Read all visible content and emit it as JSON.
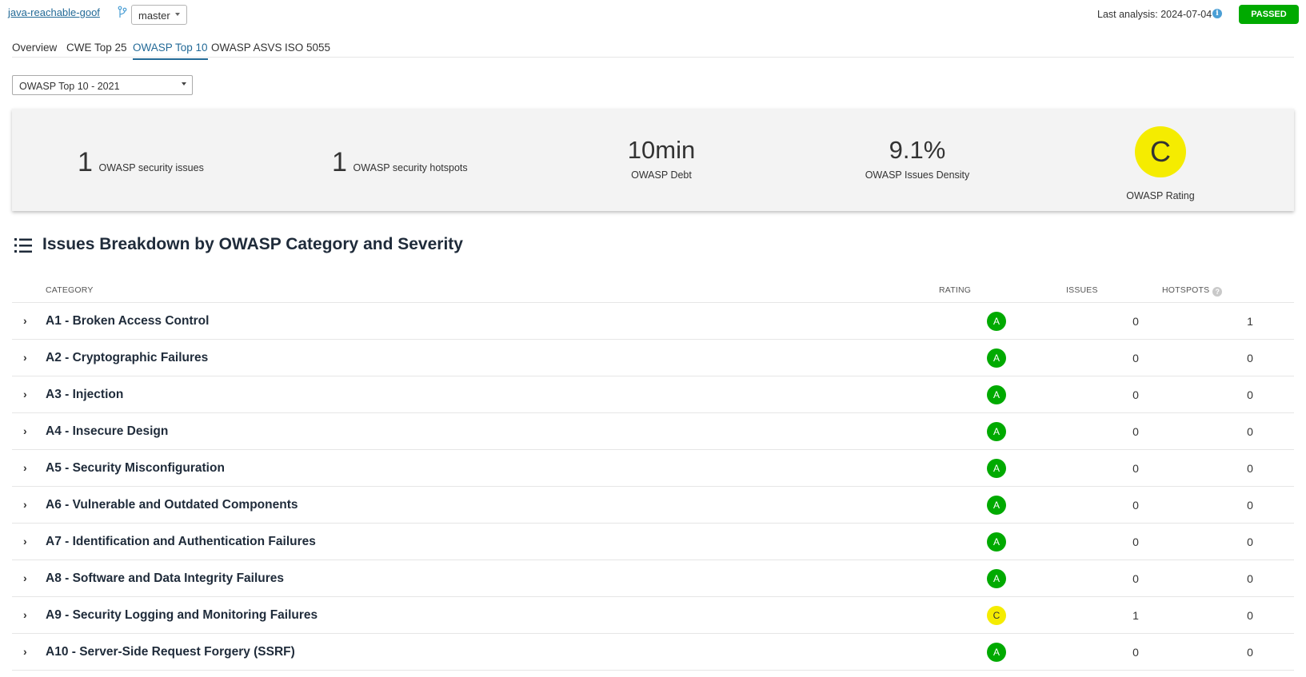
{
  "header": {
    "project": "java-reachable-goof",
    "branch": "master",
    "last_analysis": "Last analysis: 2024-07-04",
    "status": "PASSED"
  },
  "tabs": [
    "Overview",
    "CWE Top 25",
    "OWASP Top 10",
    "OWASP ASVS",
    "ISO 5055"
  ],
  "active_tab": "OWASP Top 10",
  "standard_select": "OWASP Top 10 - 2021",
  "summary": {
    "issues_count": "1",
    "issues_label": "OWASP security issues",
    "hotspots_count": "1",
    "hotspots_label": "OWASP security hotspots",
    "debt_value": "10min",
    "debt_label": "OWASP Debt",
    "density_value": "9.1%",
    "density_label": "OWASP Issues Density",
    "rating_value": "C",
    "rating_label": "OWASP Rating"
  },
  "section_title": "Issues Breakdown by OWASP Category and Severity",
  "table": {
    "headers": {
      "category": "CATEGORY",
      "rating": "RATING",
      "issues": "ISSUES",
      "hotspots": "HOTSPOTS"
    },
    "rows": [
      {
        "category": "A1 - Broken Access Control",
        "rating": "A",
        "issues": "0",
        "hotspots": "1"
      },
      {
        "category": "A2 - Cryptographic Failures",
        "rating": "A",
        "issues": "0",
        "hotspots": "0"
      },
      {
        "category": "A3 - Injection",
        "rating": "A",
        "issues": "0",
        "hotspots": "0"
      },
      {
        "category": "A4 - Insecure Design",
        "rating": "A",
        "issues": "0",
        "hotspots": "0"
      },
      {
        "category": "A5 - Security Misconfiguration",
        "rating": "A",
        "issues": "0",
        "hotspots": "0"
      },
      {
        "category": "A6 - Vulnerable and Outdated Components",
        "rating": "A",
        "issues": "0",
        "hotspots": "0"
      },
      {
        "category": "A7 - Identification and Authentication Failures",
        "rating": "A",
        "issues": "0",
        "hotspots": "0"
      },
      {
        "category": "A8 - Software and Data Integrity Failures",
        "rating": "A",
        "issues": "0",
        "hotspots": "0"
      },
      {
        "category": "A9 - Security Logging and Monitoring Failures",
        "rating": "C",
        "issues": "1",
        "hotspots": "0"
      },
      {
        "category": "A10 - Server-Side Request Forgery (SSRF)",
        "rating": "A",
        "issues": "0",
        "hotspots": "0"
      }
    ]
  },
  "colors": {
    "rating_A": "#00aa00",
    "rating_C": "#f5ec00",
    "passed": "#00aa00",
    "link": "#236a97"
  },
  "icons": {
    "branch": "branch-icon",
    "info": "info-icon",
    "list": "list-icon",
    "help": "help-icon",
    "expand": "chevron-right-icon",
    "dropdown": "caret-down-icon"
  }
}
